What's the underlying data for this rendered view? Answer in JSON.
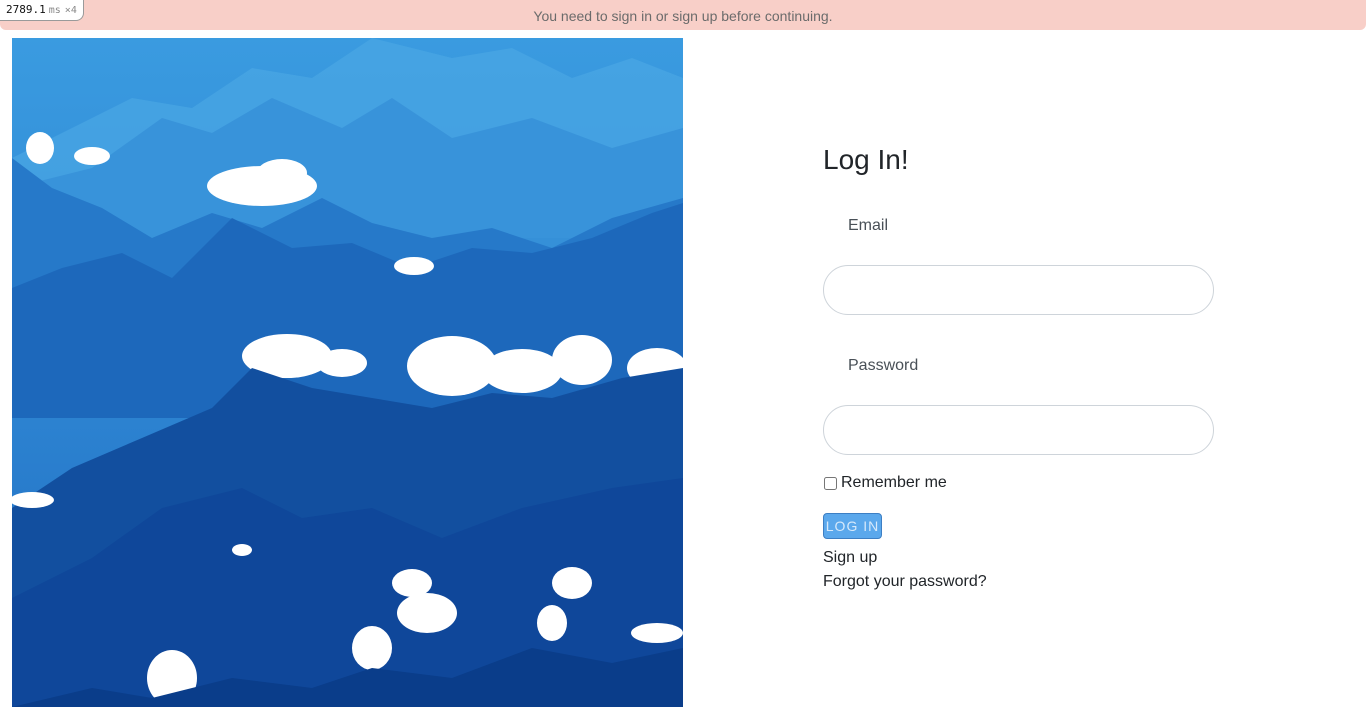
{
  "flash": {
    "message": "You need to sign in or sign up before continuing."
  },
  "perf_badge": {
    "value": "2789.1",
    "unit": "ms",
    "count": "×4"
  },
  "hero": {
    "image": "mountain-clouds-landscape",
    "colors": {
      "sky": "#2f8fd8",
      "far_mountains": "#2b7fcf",
      "mid_mountains": "#1c63b8",
      "near_mountains": "#0f4a9e",
      "clouds": "#ffffff"
    }
  },
  "form": {
    "title": "Log In!",
    "email_label": "Email",
    "email_value": "",
    "password_label": "Password",
    "password_value": "",
    "remember_label": "Remember me",
    "remember_checked": false,
    "submit_label": "LOG IN",
    "signup_link": "Sign up",
    "forgot_link": "Forgot your password?"
  },
  "colors": {
    "flash_bg": "#f8cfc8",
    "button_bg": "#5ba8ec",
    "text": "#212529"
  }
}
